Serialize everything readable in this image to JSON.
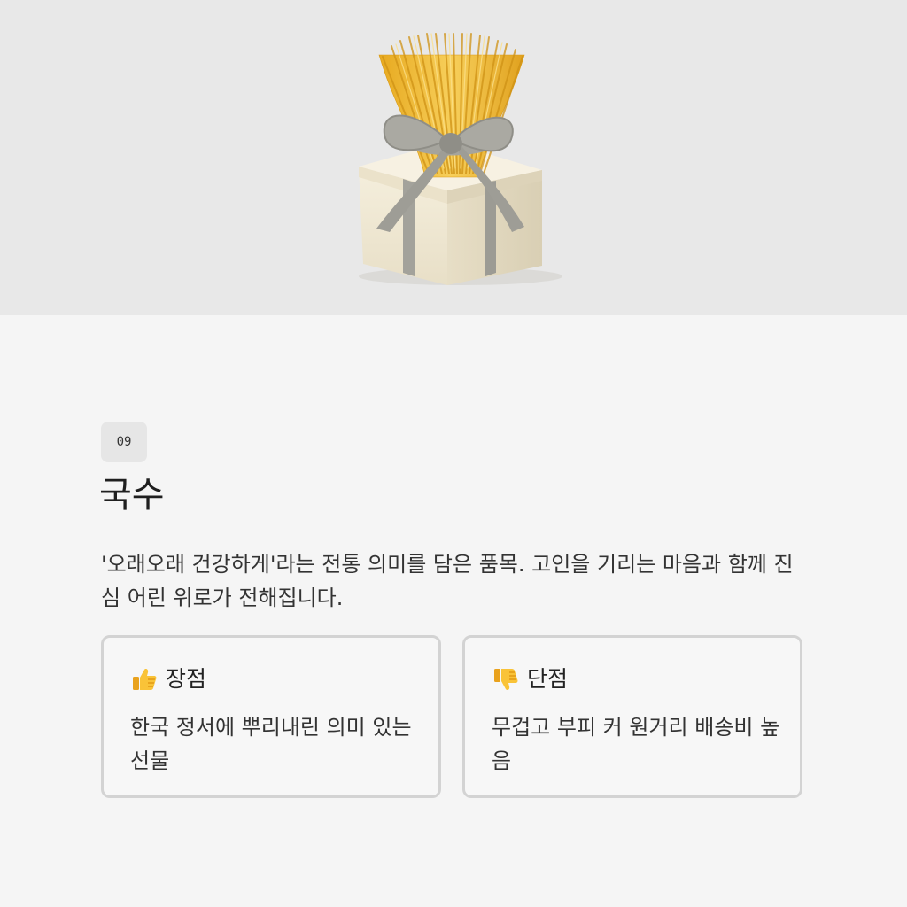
{
  "hero": {
    "illustration_icon": "noodle-gift-box-icon",
    "background_color": "#e8e8e8"
  },
  "item": {
    "number": "09",
    "title": "국수",
    "description": "'오래오래 건강하게'라는 전통 의미를 담은 품목. 고인을 기리는 마음과 함께 진심 어린 위로가 전해집니다."
  },
  "pros": {
    "icon": "thumbs-up-icon",
    "label": "장점",
    "text": "한국 정서에 뿌리내린 의미 있는 선물"
  },
  "cons": {
    "icon": "thumbs-down-icon",
    "label": "단점",
    "text": "무겁고 부피 커 원거리 배송비 높음"
  },
  "colors": {
    "page_background": "#f5f5f5",
    "card_border": "#d3d3d3",
    "noodle": "#f2be3c",
    "ribbon": "#9e9d96",
    "box": "#efe8d4"
  }
}
